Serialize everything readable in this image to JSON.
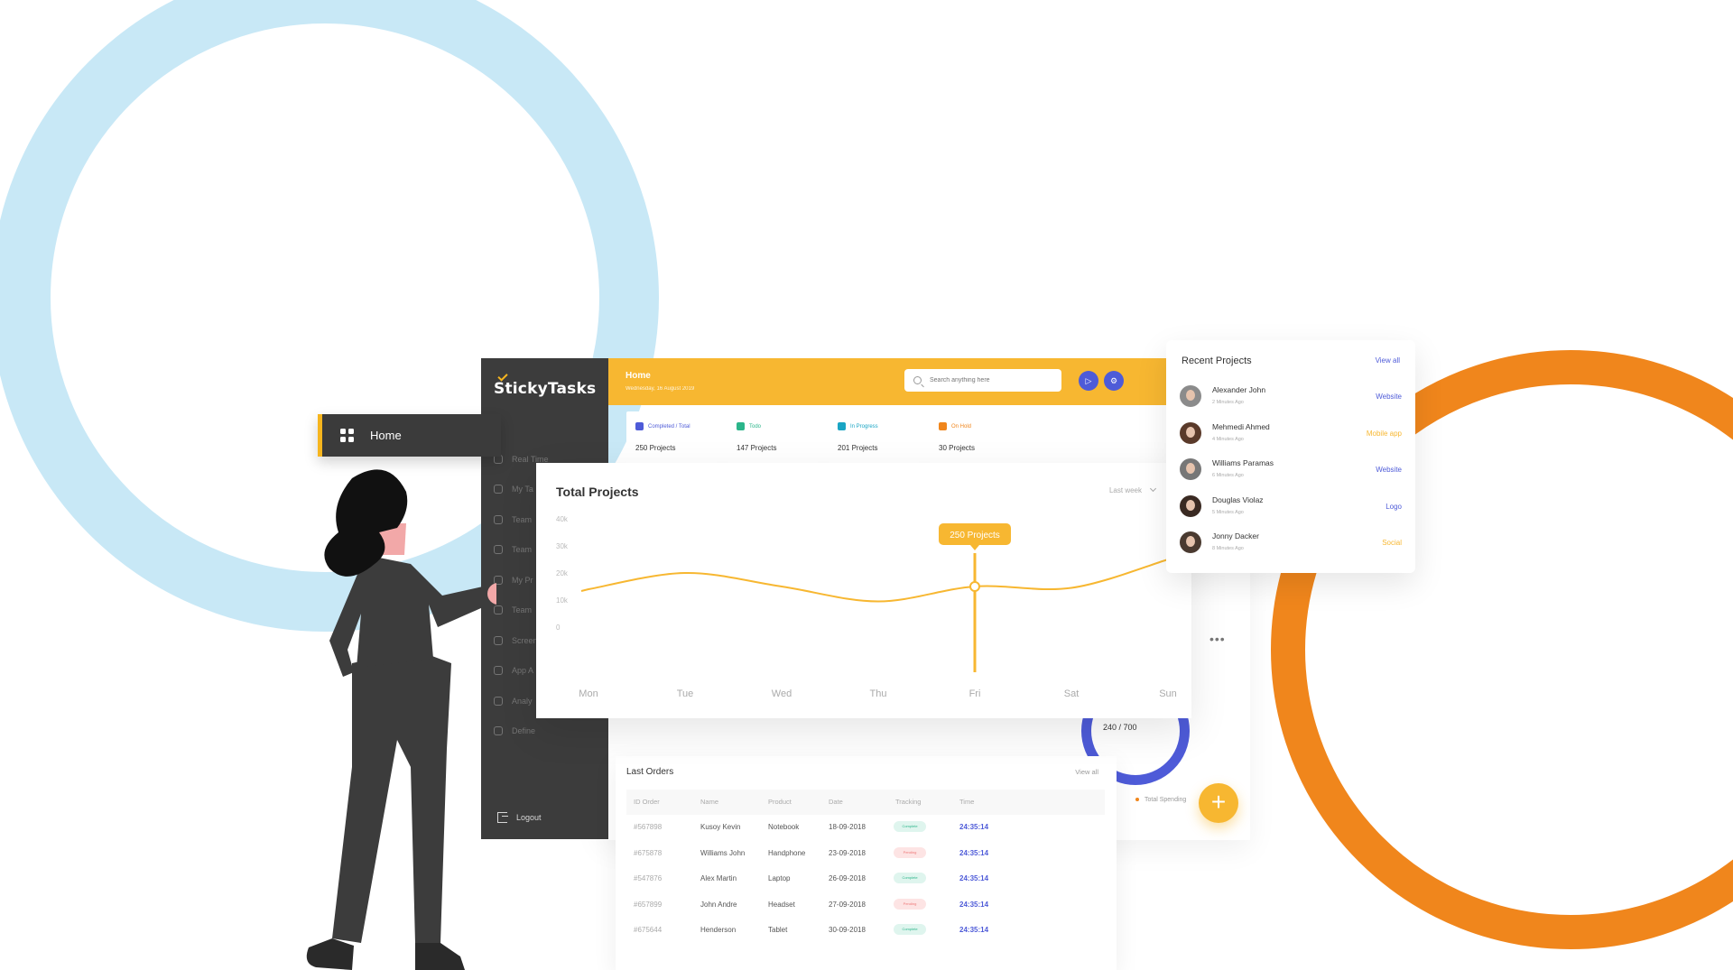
{
  "app": {
    "name": "StickyTasks"
  },
  "sidebar": {
    "items": [
      {
        "label": "Real Time"
      },
      {
        "label": "My Ta"
      },
      {
        "label": "Team"
      },
      {
        "label": "Team"
      },
      {
        "label": "My Pr"
      },
      {
        "label": "Team"
      },
      {
        "label": "Screen"
      },
      {
        "label": "App A"
      },
      {
        "label": "Analy"
      },
      {
        "label": "Define"
      }
    ],
    "logout": "Logout"
  },
  "home_nav": {
    "label": "Home"
  },
  "header": {
    "breadcrumb": "Home",
    "date": "Wednesday, 16 August 2019",
    "search_placeholder": "Search anything here"
  },
  "stats": [
    {
      "label": "Completed / Total",
      "value": "250 Projects",
      "color": "#4e5bd8"
    },
    {
      "label": "Todo",
      "value": "147 Projects",
      "color": "#2bb58a"
    },
    {
      "label": "In Progress",
      "value": "201 Projects",
      "color": "#1aa5c4"
    },
    {
      "label": "On Hold",
      "value": "30 Projects",
      "color": "#f0861c"
    }
  ],
  "total_projects": {
    "title": "Total Projects",
    "filter": "Last week",
    "tooltip": "250 Projects"
  },
  "chart_data": {
    "type": "line",
    "title": "Total Projects",
    "categories": [
      "Mon",
      "Tue",
      "Wed",
      "Thu",
      "Fri",
      "Sat",
      "Sun"
    ],
    "y_ticks": [
      "40k",
      "30k",
      "20k",
      "10k",
      "0"
    ],
    "ylim": [
      0,
      40
    ],
    "series": [
      {
        "values": [
          14,
          20,
          15,
          9.5,
          15,
          14.5,
          25
        ]
      }
    ],
    "grid": false,
    "highlight_category": "Fri",
    "color": "#f7b731"
  },
  "recent_projects": {
    "title": "Recent Projects",
    "view_all": "View all",
    "items": [
      {
        "name": "Alexander John",
        "time": "2 Minutes Ago",
        "tag": "Website",
        "tag_color": "#4e5bd8",
        "avatar_color": "#8b8b8b"
      },
      {
        "name": "Mehmedi Ahmed",
        "time": "4 Minutes Ago",
        "tag": "Mobile app",
        "tag_color": "#f7b731",
        "avatar_color": "#5a3a2a"
      },
      {
        "name": "Williams Paramas",
        "time": "6 Minutes Ago",
        "tag": "Website",
        "tag_color": "#4e5bd8",
        "avatar_color": "#777777"
      },
      {
        "name": "Douglas Violaz",
        "time": "5 Minutes Ago",
        "tag": "Logo",
        "tag_color": "#4e5bd8",
        "avatar_color": "#3a2a22"
      },
      {
        "name": "Jonny Dacker",
        "time": "8 Minutes Ago",
        "tag": "Social",
        "tag_color": "#f7b731",
        "avatar_color": "#4a3a30"
      }
    ]
  },
  "spending": {
    "donut_label": "240 / 700",
    "legend": "Total Spending"
  },
  "last_orders": {
    "title": "Last Orders",
    "view_all": "View all",
    "columns": [
      "ID Order",
      "Name",
      "Product",
      "Date",
      "Tracking",
      "Time"
    ],
    "rows": [
      {
        "id": "#567898",
        "name": "Kusoy Kevin",
        "product": "Notebook",
        "date": "18-09-2018",
        "tracking": "Complete",
        "status": "complete",
        "time": "24:35:14"
      },
      {
        "id": "#675878",
        "name": "Williams John",
        "product": "Handphone",
        "date": "23-09-2018",
        "tracking": "Pending",
        "status": "pending",
        "time": "24:35:14"
      },
      {
        "id": "#547876",
        "name": "Alex Martin",
        "product": "Laptop",
        "date": "26-09-2018",
        "tracking": "Complete",
        "status": "complete",
        "time": "24:35:14"
      },
      {
        "id": "#657899",
        "name": "John Andre",
        "product": "Headset",
        "date": "27-09-2018",
        "tracking": "Pending",
        "status": "pending",
        "time": "24:35:14"
      },
      {
        "id": "#675644",
        "name": "Henderson",
        "product": "Tablet",
        "date": "30-09-2018",
        "tracking": "Complete",
        "status": "complete",
        "time": "24:35:14"
      }
    ]
  }
}
